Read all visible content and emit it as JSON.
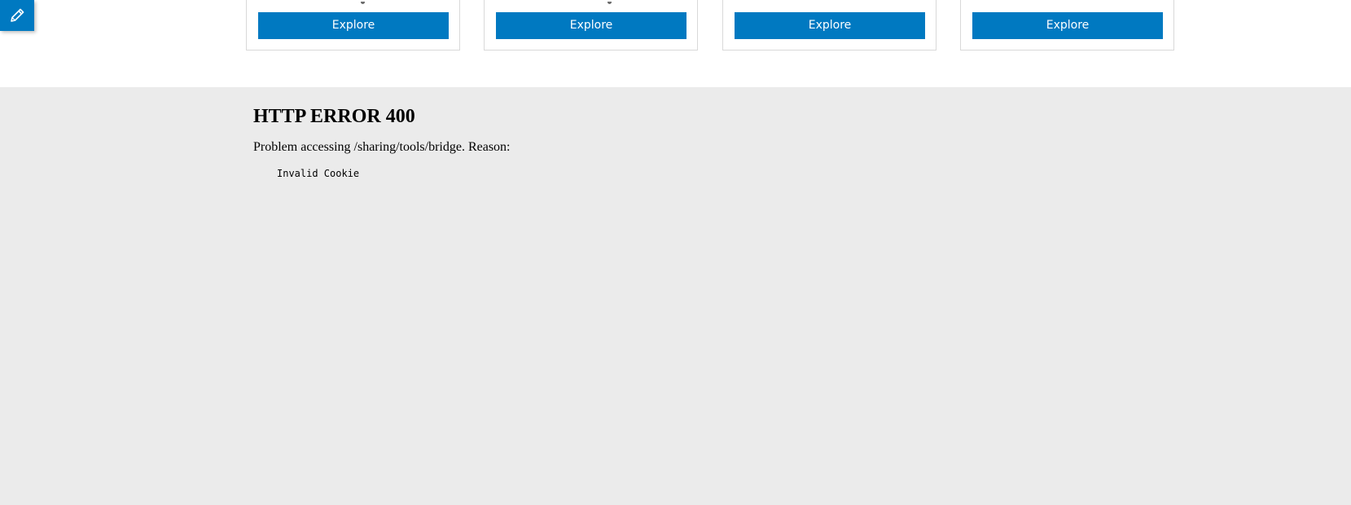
{
  "edit_tab": {
    "icon": "pencil-icon",
    "background": "#0079c1"
  },
  "cards": [
    {
      "button_label": "Explore"
    },
    {
      "button_label": "Explore"
    },
    {
      "button_label": "Explore"
    },
    {
      "button_label": "Explore"
    }
  ],
  "colors": {
    "accent": "#0079c1",
    "page_background": "#ebebeb",
    "top_background": "#ffffff"
  },
  "error": {
    "title": "HTTP ERROR 400",
    "message": "Problem accessing /sharing/tools/bridge. Reason:",
    "reason": "Invalid Cookie"
  }
}
